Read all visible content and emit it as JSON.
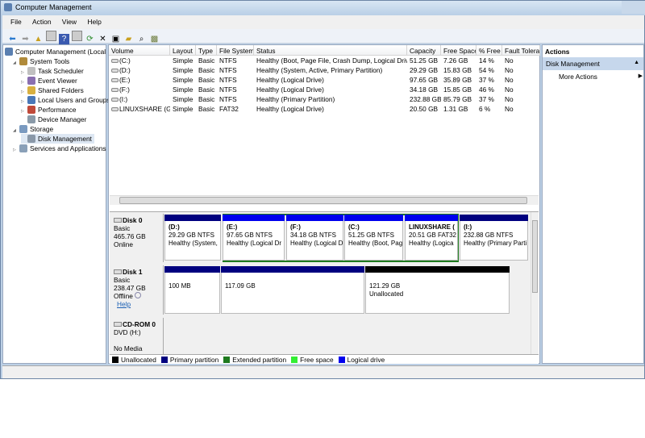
{
  "window": {
    "title": "Computer Management"
  },
  "menu": [
    "File",
    "Action",
    "View",
    "Help"
  ],
  "toolbar": [
    "back-icon",
    "forward-icon",
    "up-icon",
    "show-hide-tree-icon",
    "help-icon",
    "show-hide-action-icon",
    "refresh-icon",
    "delete-icon",
    "properties-icon",
    "open-icon",
    "search-icon",
    "settings-icon"
  ],
  "tree": [
    {
      "label": "Computer Management (Local",
      "level": 0,
      "icon": "computer-icon",
      "color": "#5a7fb0"
    },
    {
      "label": "System Tools",
      "level": 1,
      "icon": "tools-icon",
      "color": "#b08a3a",
      "exp": "◢"
    },
    {
      "label": "Task Scheduler",
      "level": 2,
      "icon": "clock-icon",
      "color": "#c0c0c0",
      "exp": "▷"
    },
    {
      "label": "Event Viewer",
      "level": 2,
      "icon": "event-viewer-icon",
      "color": "#8a6fb0",
      "exp": "▷"
    },
    {
      "label": "Shared Folders",
      "level": 2,
      "icon": "shared-folder-icon",
      "color": "#d8b040",
      "exp": "▷"
    },
    {
      "label": "Local Users and Groups",
      "level": 2,
      "icon": "users-icon",
      "color": "#4a78b8",
      "exp": "▷"
    },
    {
      "label": "Performance",
      "level": 2,
      "icon": "performance-icon",
      "color": "#c04a3a",
      "exp": "▷"
    },
    {
      "label": "Device Manager",
      "level": 2,
      "icon": "device-manager-icon",
      "color": "#8a9aa8",
      "exp": ""
    },
    {
      "label": "Storage",
      "level": 1,
      "icon": "storage-icon",
      "color": "#7a9ac0",
      "exp": "◢"
    },
    {
      "label": "Disk Management",
      "level": 2,
      "icon": "disk-management-icon",
      "color": "#8a98a8",
      "exp": "",
      "sel": true
    },
    {
      "label": "Services and Applications",
      "level": 1,
      "icon": "services-icon",
      "color": "#8aa0b8",
      "exp": "▷"
    }
  ],
  "table": {
    "columns": [
      "Volume",
      "Layout",
      "Type",
      "File System",
      "Status",
      "Capacity",
      "Free Space",
      "% Free",
      "Fault Tolera"
    ],
    "rows": [
      [
        "(C:)",
        "Simple",
        "Basic",
        "NTFS",
        "Healthy (Boot, Page File, Crash Dump, Logical Drive)",
        "51.25 GB",
        "7.26 GB",
        "14 %",
        "No"
      ],
      [
        "(D:)",
        "Simple",
        "Basic",
        "NTFS",
        "Healthy (System, Active, Primary Partition)",
        "29.29 GB",
        "15.83 GB",
        "54 %",
        "No"
      ],
      [
        "(E:)",
        "Simple",
        "Basic",
        "NTFS",
        "Healthy (Logical Drive)",
        "97.65 GB",
        "35.89 GB",
        "37 %",
        "No"
      ],
      [
        "(F:)",
        "Simple",
        "Basic",
        "NTFS",
        "Healthy (Logical Drive)",
        "34.18 GB",
        "15.85 GB",
        "46 %",
        "No"
      ],
      [
        "(I:)",
        "Simple",
        "Basic",
        "NTFS",
        "Healthy (Primary Partition)",
        "232.88 GB",
        "85.79 GB",
        "37 %",
        "No"
      ],
      [
        "LINUXSHARE (G:)",
        "Simple",
        "Basic",
        "FAT32",
        "Healthy (Logical Drive)",
        "20.50 GB",
        "1.31 GB",
        "6 %",
        "No"
      ]
    ]
  },
  "disks": [
    {
      "name": "Disk 0",
      "type": "Basic",
      "size": "465.76 GB",
      "state": "Online",
      "partitions": [
        {
          "name": "(D:)",
          "size": "29.29 GB NTFS",
          "status": "Healthy (System,",
          "kind": "primary"
        },
        {
          "name": "(E:)",
          "size": "97.65 GB NTFS",
          "status": "Healthy (Logical Dr",
          "kind": "logical"
        },
        {
          "name": "(F:)",
          "size": "34.18 GB NTFS",
          "status": "Healthy (Logical D",
          "kind": "logical"
        },
        {
          "name": "(C:)",
          "size": "51.25 GB NTFS",
          "status": "Healthy (Boot, Pag",
          "kind": "logical"
        },
        {
          "name": "LINUXSHARE (",
          "size": "20.51 GB FAT32",
          "status": "Healthy (Logica",
          "kind": "logical"
        },
        {
          "name": "(I:)",
          "size": "232.88 GB NTFS",
          "status": "Healthy (Primary Parti",
          "kind": "primary"
        }
      ]
    },
    {
      "name": "Disk 1",
      "type": "Basic",
      "size": "238.47 GB",
      "state": "Offline",
      "help": "Help",
      "partitions": [
        {
          "name": "",
          "size": "100 MB",
          "status": "",
          "kind": "primary"
        },
        {
          "name": "",
          "size": "117.09 GB",
          "status": "",
          "kind": "primary"
        },
        {
          "name": "",
          "size": "121.29 GB",
          "status": "Unallocated",
          "kind": "unallocated"
        }
      ]
    },
    {
      "name": "CD-ROM 0",
      "type": "DVD (H:)",
      "size": "",
      "state": "No Media"
    }
  ],
  "legend": [
    {
      "label": "Unallocated",
      "color": "#000000"
    },
    {
      "label": "Primary partition",
      "color": "#00007f"
    },
    {
      "label": "Extended partition",
      "color": "#1e7a1e"
    },
    {
      "label": "Free space",
      "color": "#33ee33"
    },
    {
      "label": "Logical drive",
      "color": "#0000ee"
    }
  ],
  "actions": {
    "header": "Actions",
    "section": "Disk Management",
    "items": [
      "More Actions"
    ]
  }
}
